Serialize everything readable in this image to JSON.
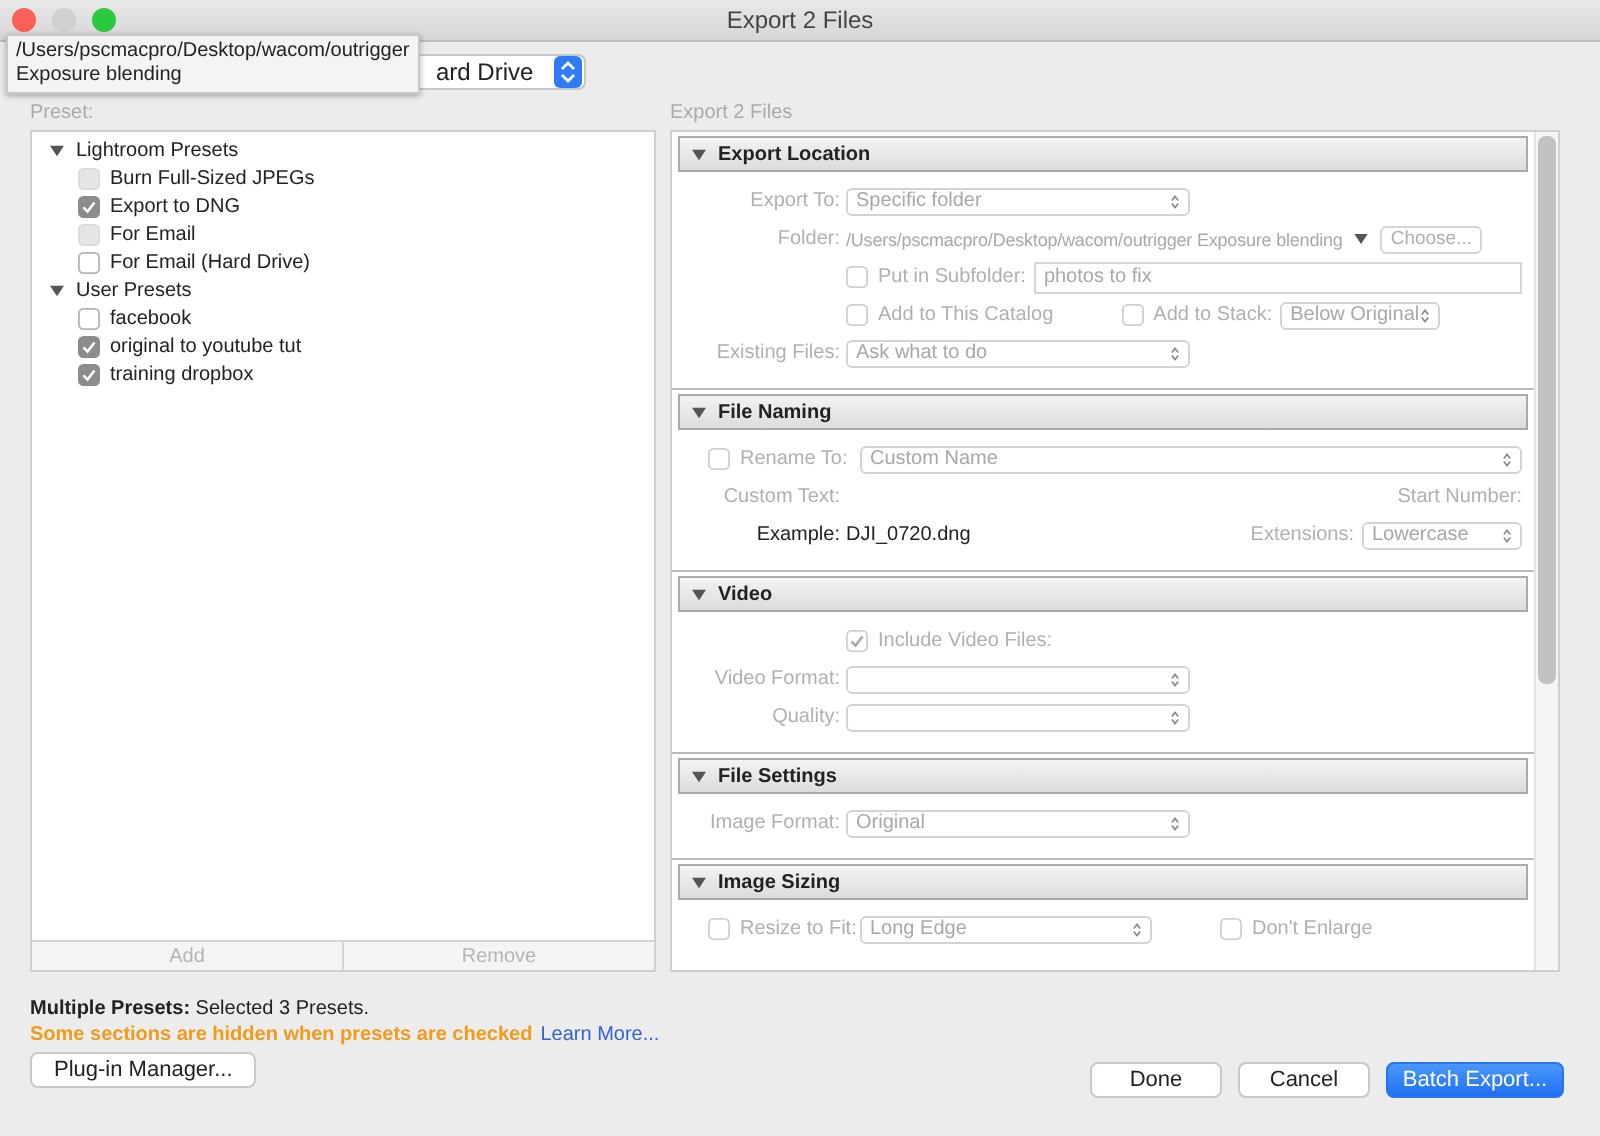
{
  "window": {
    "title": "Export 2 Files"
  },
  "tooltip": {
    "lines": [
      "/Users/pscmacpro/Desktop/wacom/outrigger",
      "Exposure blending"
    ]
  },
  "export_to": {
    "value": "ard Drive"
  },
  "presets": {
    "caption": "Preset:",
    "groups": [
      {
        "label": "Lightroom Presets",
        "expanded": true,
        "children": [
          {
            "label": "Burn Full-Sized JPEGs",
            "checked": false,
            "disabled": true
          },
          {
            "label": "Export to DNG",
            "checked": true,
            "disabled": false
          },
          {
            "label": "For Email",
            "checked": false,
            "disabled": true
          },
          {
            "label": "For Email (Hard Drive)",
            "checked": false,
            "disabled": false
          }
        ]
      },
      {
        "label": "User Presets",
        "expanded": true,
        "children": [
          {
            "label": "facebook",
            "checked": false,
            "disabled": false
          },
          {
            "label": "original to youtube tut",
            "checked": true,
            "disabled": false
          },
          {
            "label": "training dropbox",
            "checked": true,
            "disabled": false
          }
        ]
      }
    ],
    "buttons": [
      {
        "label": "Add",
        "disabled": true
      },
      {
        "label": "Remove",
        "disabled": true
      }
    ]
  },
  "settings": {
    "caption": "Export 2 Files",
    "sections": [
      {
        "title": "Export Location",
        "expanded": true,
        "rows": [
          {
            "lead": {
              "kind": "label",
              "text": "Export To:",
              "disabled": true
            },
            "items": [
              {
                "kind": "select",
                "value": "Specific folder",
                "disabled": true
              }
            ]
          },
          {
            "lead": {
              "kind": "label",
              "text": "Folder:",
              "disabled": true
            },
            "items": [
              {
                "kind": "path",
                "text": "/Users/pscmacpro/Desktop/wacom/outrigger Exposure blending",
                "disabled": true
              },
              {
                "kind": "button",
                "label": "Choose...",
                "disabled": true
              }
            ]
          },
          {
            "items": [
              {
                "kind": "checkbox",
                "label": "Put in Subfolder:",
                "checked": false,
                "disabled": true
              },
              {
                "kind": "field",
                "value": "photos to fix",
                "disabled": true
              }
            ]
          },
          {
            "items": [
              {
                "kind": "checkbox",
                "label": "Add to This Catalog",
                "checked": false,
                "disabled": true
              },
              {
                "kind": "checkbox",
                "label": "Add to Stack:",
                "checked": false,
                "disabled": true
              },
              {
                "kind": "select",
                "value": "Below Original",
                "disabled": true
              }
            ]
          },
          {
            "lead": {
              "kind": "label",
              "text": "Existing Files:",
              "disabled": true
            },
            "items": [
              {
                "kind": "select",
                "value": "Ask what to do",
                "disabled": true
              }
            ]
          }
        ]
      },
      {
        "title": "File Naming",
        "expanded": true,
        "rows": [
          {
            "lead": {
              "kind": "checkbox",
              "label": "Rename To:",
              "checked": false,
              "disabled": true
            },
            "items": [
              {
                "kind": "select",
                "value": "Custom Name",
                "disabled": true
              }
            ]
          },
          {
            "lead": {
              "kind": "label",
              "text": "Custom Text:",
              "disabled": true
            },
            "items": [
              {
                "kind": "label",
                "text": "Start Number:",
                "disabled": true
              }
            ]
          },
          {
            "lead": {
              "kind": "label",
              "text": "Example:",
              "disabled": false
            },
            "items": [
              {
                "kind": "text",
                "text": "DJI_0720.dng",
                "disabled": false
              },
              {
                "kind": "label",
                "text": "Extensions:",
                "disabled": true
              },
              {
                "kind": "select",
                "value": "Lowercase",
                "disabled": true
              }
            ]
          }
        ]
      },
      {
        "title": "Video",
        "expanded": true,
        "rows": [
          {
            "items": [
              {
                "kind": "checkbox",
                "label": "Include Video Files:",
                "checked": true,
                "disabled": true
              }
            ]
          },
          {
            "lead": {
              "kind": "label",
              "text": "Video Format:",
              "disabled": true
            },
            "items": [
              {
                "kind": "select",
                "disabled": true
              }
            ]
          },
          {
            "lead": {
              "kind": "label",
              "text": "Quality:",
              "disabled": true
            },
            "items": [
              {
                "kind": "select",
                "disabled": true
              }
            ]
          }
        ]
      },
      {
        "title": "File Settings",
        "expanded": true,
        "rows": [
          {
            "lead": {
              "kind": "label",
              "text": "Image Format:",
              "disabled": true
            },
            "items": [
              {
                "kind": "select",
                "value": "Original",
                "disabled": true
              }
            ]
          }
        ]
      },
      {
        "title": "Image Sizing",
        "expanded": true,
        "rows": [
          {
            "lead": {
              "kind": "checkbox",
              "label": "Resize to Fit:",
              "checked": false,
              "disabled": true
            },
            "items": [
              {
                "kind": "select",
                "value": "Long Edge",
                "disabled": true
              },
              {
                "kind": "checkbox",
                "label": "Don't Enlarge",
                "checked": false,
                "disabled": true
              }
            ]
          }
        ]
      }
    ]
  },
  "status": {
    "summary": "**Multiple Presets:** Selected 3 Presets.",
    "warning": "Some sections are hidden when presets are checked",
    "link": "Learn More..."
  },
  "footer": {
    "plugin": "Plug-in Manager...",
    "actions": [
      {
        "label": "Done",
        "primary": false
      },
      {
        "label": "Cancel",
        "primary": false
      },
      {
        "label": "Batch Export...",
        "primary": true
      }
    ]
  }
}
